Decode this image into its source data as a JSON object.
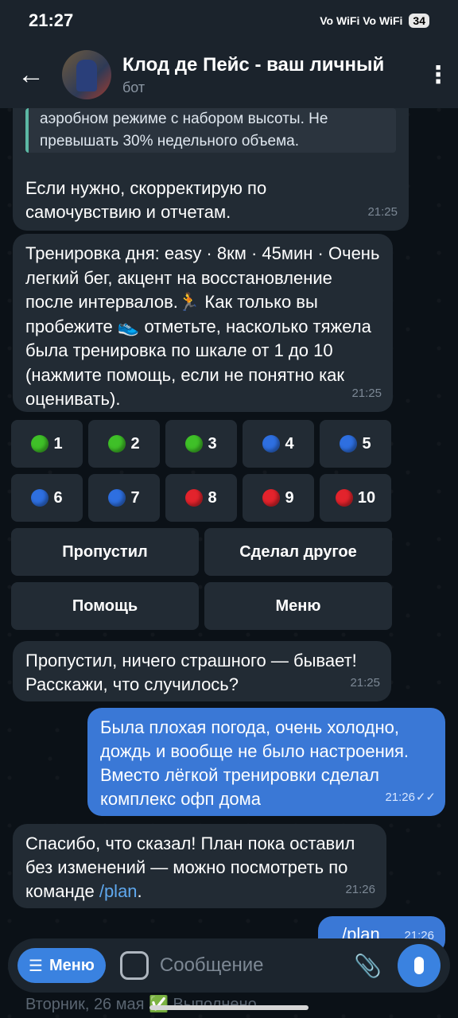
{
  "status_bar": {
    "time": "21:27",
    "indicators": "Vo WiFi  Vo WiFi",
    "battery": "34"
  },
  "header": {
    "title": "Клод де Пейс - ваш личный",
    "subtitle": "бот"
  },
  "messages": [
    {
      "quote": "аэробном режиме с набором высоты. Не превышать 30% недельного объема.",
      "text": "Если нужно, скорректирую по самочувствию и отчетам.",
      "time": "21:25"
    },
    {
      "text_part1": "Тренировка дня: easy · 8км · 45мин · Очень легкий бег, акцент на восстановление после интервалов.",
      "runner_icon": "🏃",
      "text_part2": "Как только вы пробежите",
      "shoe_icon": "👟",
      "text_part3": "отметьте, насколько тяжела была тренировка по шкале от 1 до 10 (нажмите помощь, если не понятно как оценивать).",
      "time": "21:25"
    },
    {
      "text": "Пропустил, ничего страшного — бывает! Расскажи, что случилось?",
      "time": "21:25"
    },
    {
      "text": "Была плохая погода, очень холодно, дождь и вообще не было настроения. Вместо лёгкой тренировки сделал комплекс офп дома",
      "time": "21:26"
    },
    {
      "text": "Спасибо, что сказал! План пока оставил без изменений — можно посмотреть по команде",
      "command": "/plan",
      "time": "21:26"
    },
    {
      "text": "/plan",
      "time": "21:26"
    }
  ],
  "rating_buttons": [
    {
      "label": "1",
      "color": "green"
    },
    {
      "label": "2",
      "color": "green"
    },
    {
      "label": "3",
      "color": "green"
    },
    {
      "label": "4",
      "color": "blue"
    },
    {
      "label": "5",
      "color": "blue"
    },
    {
      "label": "6",
      "color": "blue"
    },
    {
      "label": "7",
      "color": "blue"
    },
    {
      "label": "8",
      "color": "red"
    },
    {
      "label": "9",
      "color": "red"
    },
    {
      "label": "10",
      "color": "red"
    }
  ],
  "action_buttons": {
    "skipped": "Пропустил",
    "did_other": "Сделал другое",
    "help": "Помощь",
    "menu": "Меню"
  },
  "input": {
    "menu_label": "Меню",
    "placeholder": "Сообщение"
  },
  "below_text": "Вторник, 26 мая ✅ Выполнено",
  "colors": {
    "background": "#0b1117",
    "incoming_bubble": "#222b34",
    "outgoing_bubble": "#3a78d6",
    "accent": "#3a82e0"
  }
}
